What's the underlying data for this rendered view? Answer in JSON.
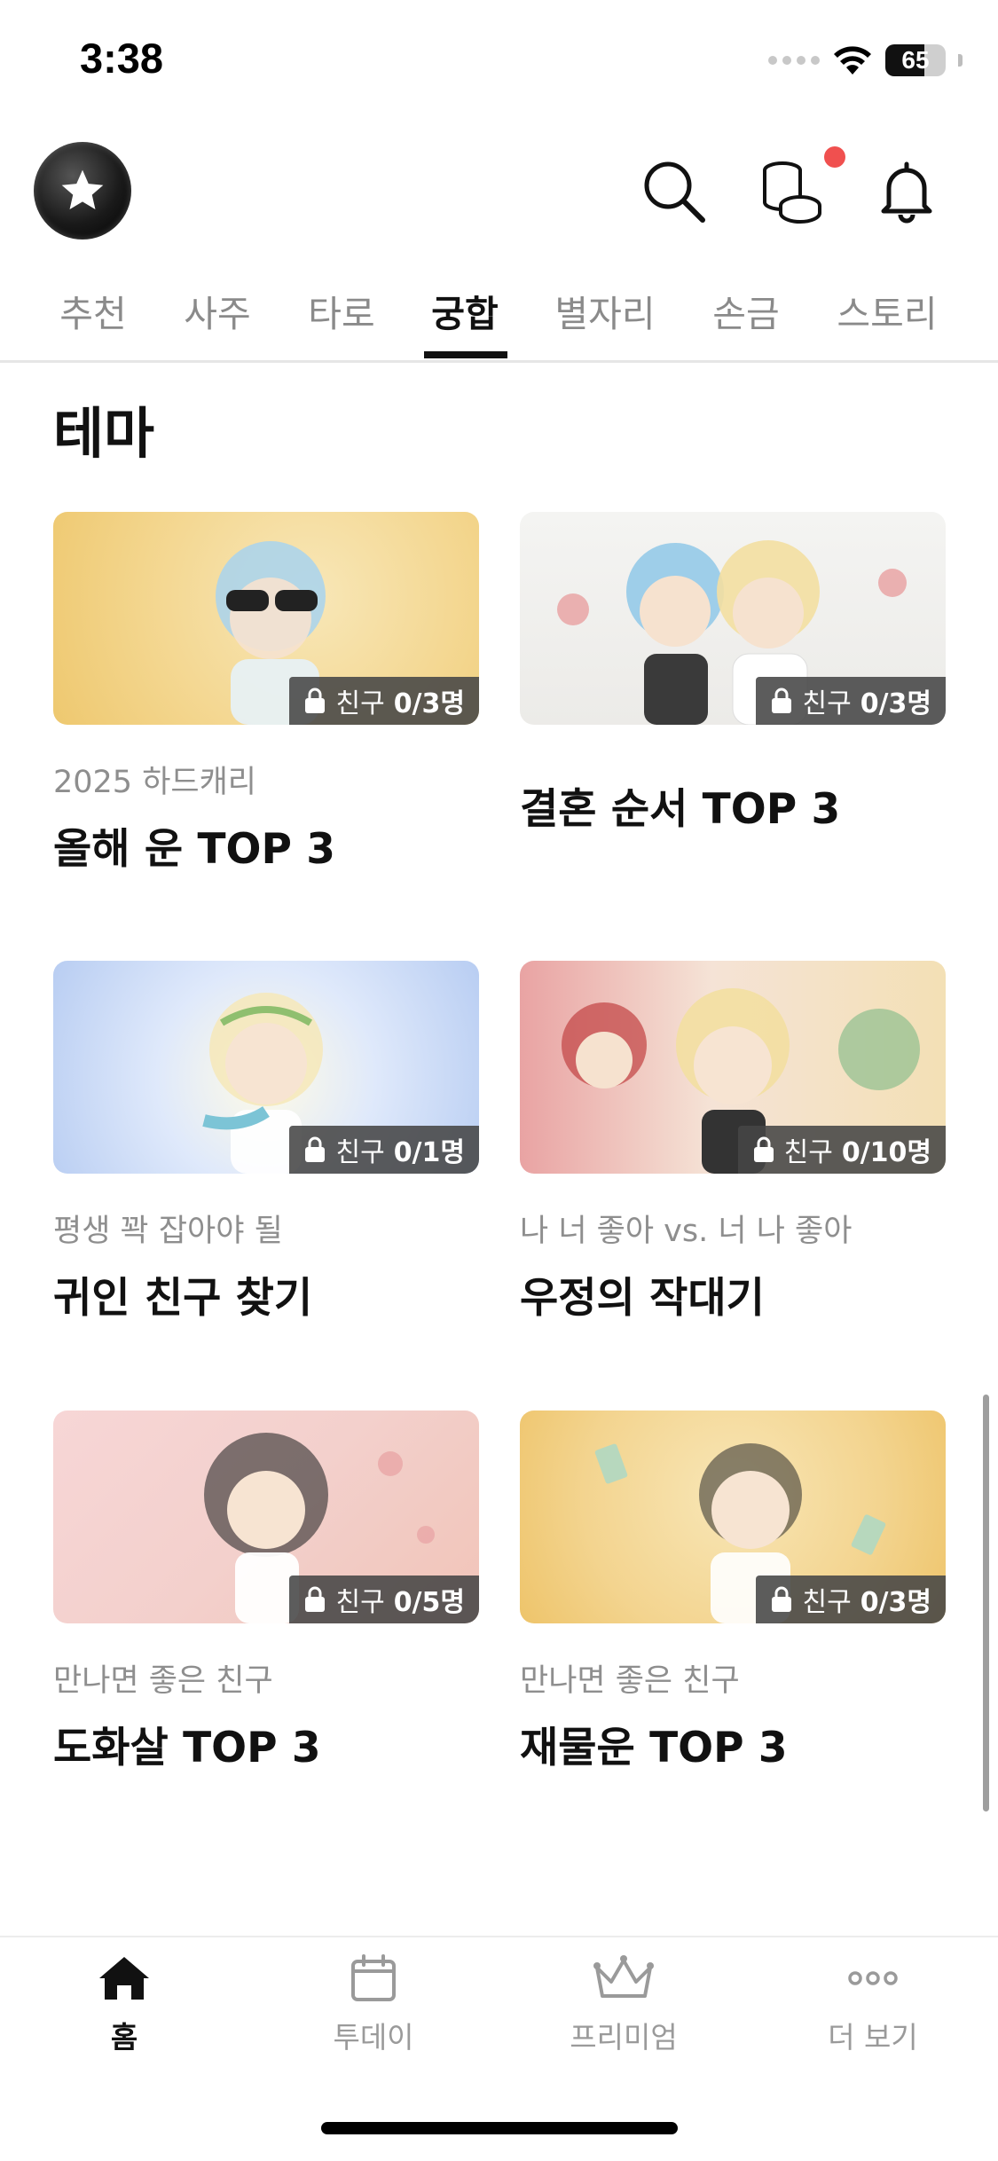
{
  "status_bar": {
    "time": "3:38",
    "battery": "65"
  },
  "header": {
    "logo_icon": "star-badge-icon",
    "icons": [
      "search-icon",
      "coins-icon",
      "bell-icon"
    ],
    "has_notification": true
  },
  "tabs": [
    {
      "label": "추천",
      "active": false
    },
    {
      "label": "사주",
      "active": false
    },
    {
      "label": "타로",
      "active": false
    },
    {
      "label": "궁합",
      "active": true
    },
    {
      "label": "별자리",
      "active": false
    },
    {
      "label": "손금",
      "active": false
    },
    {
      "label": "스토리",
      "active": false
    }
  ],
  "section": {
    "title": "테마"
  },
  "cards": [
    {
      "subtitle": "2025 하드캐리",
      "title": "올해 운 TOP 3",
      "badge_prefix": "친구",
      "badge_count": "0/3명"
    },
    {
      "subtitle": "",
      "title": "결혼 순서 TOP 3",
      "badge_prefix": "친구",
      "badge_count": "0/3명"
    },
    {
      "subtitle": "평생 꽉 잡아야 될",
      "title": "귀인 친구 찾기",
      "badge_prefix": "친구",
      "badge_count": "0/1명"
    },
    {
      "subtitle": "나 너 좋아 vs. 너 나 좋아",
      "title": "우정의 작대기",
      "badge_prefix": "친구",
      "badge_count": "0/10명"
    },
    {
      "subtitle": "만나면 좋은 친구",
      "title": "도화살 TOP 3",
      "badge_prefix": "친구",
      "badge_count": "0/5명"
    },
    {
      "subtitle": "만나면 좋은 친구",
      "title": "재물운 TOP 3",
      "badge_prefix": "친구",
      "badge_count": "0/3명"
    }
  ],
  "bottom_nav": [
    {
      "label": "홈",
      "icon": "home-icon",
      "active": true
    },
    {
      "label": "투데이",
      "icon": "calendar-icon",
      "active": false
    },
    {
      "label": "프리미엄",
      "icon": "crown-icon",
      "active": false
    },
    {
      "label": "더 보기",
      "icon": "more-dots-icon",
      "active": false
    }
  ],
  "colors": {
    "accent": "#111111",
    "notification": "#f0504f",
    "muted": "#8a8a8a"
  }
}
